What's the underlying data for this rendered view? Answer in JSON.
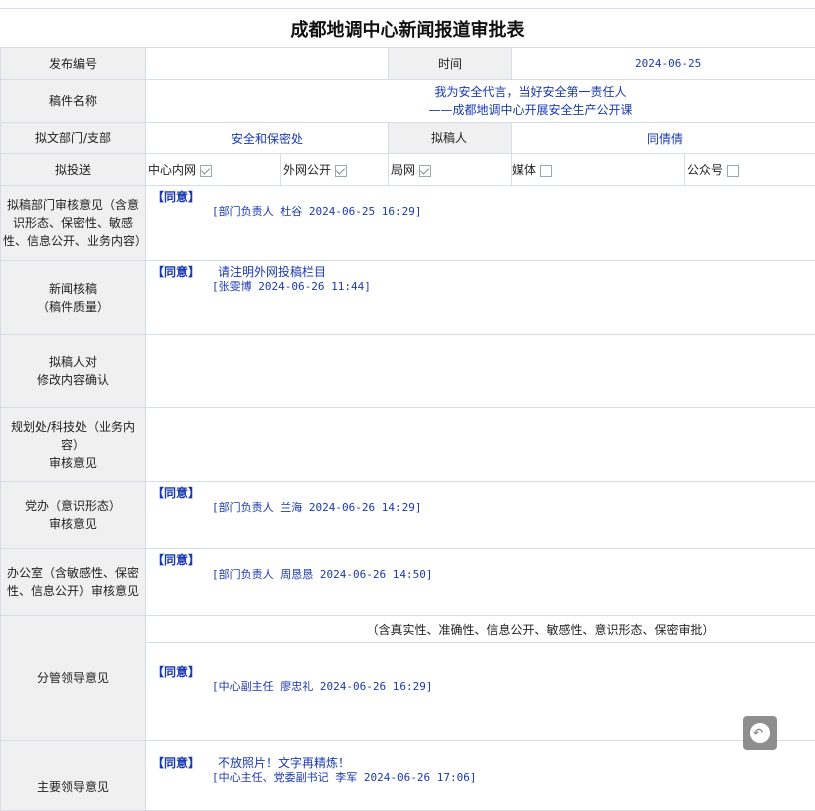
{
  "title": "成都地调中心新闻报道审批表",
  "row_publish": {
    "label": "发布编号",
    "value": "",
    "time_label": "时间",
    "time_value": "2024-06-25"
  },
  "row_name": {
    "label": "稿件名称",
    "line1": "我为安全代言，当好安全第一责任人",
    "line2": "——成都地调中心开展安全生产公开课"
  },
  "row_dept": {
    "label": "拟文部门/支部",
    "value": "安全和保密处",
    "author_label": "拟稿人",
    "author_value": "同倩倩"
  },
  "row_dist": {
    "label": "拟投送",
    "options": [
      {
        "label": "中心内网",
        "checked": true
      },
      {
        "label": "外网公开",
        "checked": true
      },
      {
        "label": "局网",
        "checked": true
      },
      {
        "label": "媒体",
        "checked": false
      },
      {
        "label": "公众号",
        "checked": false
      }
    ]
  },
  "rows": {
    "dept_review": {
      "label": "拟稿部门审核意见（含意识形态、保密性、敏感性、信息公开、业务内容）",
      "agree": "【同意】",
      "sign": "[部门负责人 杜谷 2024-06-25 16:29]"
    },
    "news_check": {
      "label1": "新闻核稿",
      "label2": "（稿件质量）",
      "agree": "【同意】",
      "note": "请注明外网投稿栏目",
      "sign": "[张雯博 2024-06-26 11:44]"
    },
    "author_confirm": {
      "label1": "拟稿人对",
      "label2": "修改内容确认"
    },
    "planning": {
      "label1": "规划处/科技处（业务内容）",
      "label2": "审核意见"
    },
    "party": {
      "label1": "党办（意识形态）",
      "label2": "审核意见",
      "agree": "【同意】",
      "sign": "[部门负责人 兰海 2024-06-26 14:29]"
    },
    "office": {
      "label": "办公室（含敏感性、保密性、信息公开）审核意见",
      "agree": "【同意】",
      "sign": "[部门负责人 周恳恳 2024-06-26 14:50]"
    },
    "leader": {
      "label": "分管领导意见",
      "scope": "（含真实性、准确性、信息公开、敏感性、意识形态、保密审批）",
      "agree": "【同意】",
      "sign": "[中心副主任 廖忠礼 2024-06-26 16:29]"
    },
    "main_leader": {
      "label": "主要领导意见",
      "agree": "【同意】",
      "note": "不放照片！文字再精炼！",
      "sign": "[中心主任、党委副书记 李军 2024-06-26 17:06]"
    }
  },
  "colors": {
    "link": "#1a39b0",
    "label_bg": "#f0f0f0",
    "border": "#d6dde6"
  },
  "fab_icon": "reply-icon"
}
